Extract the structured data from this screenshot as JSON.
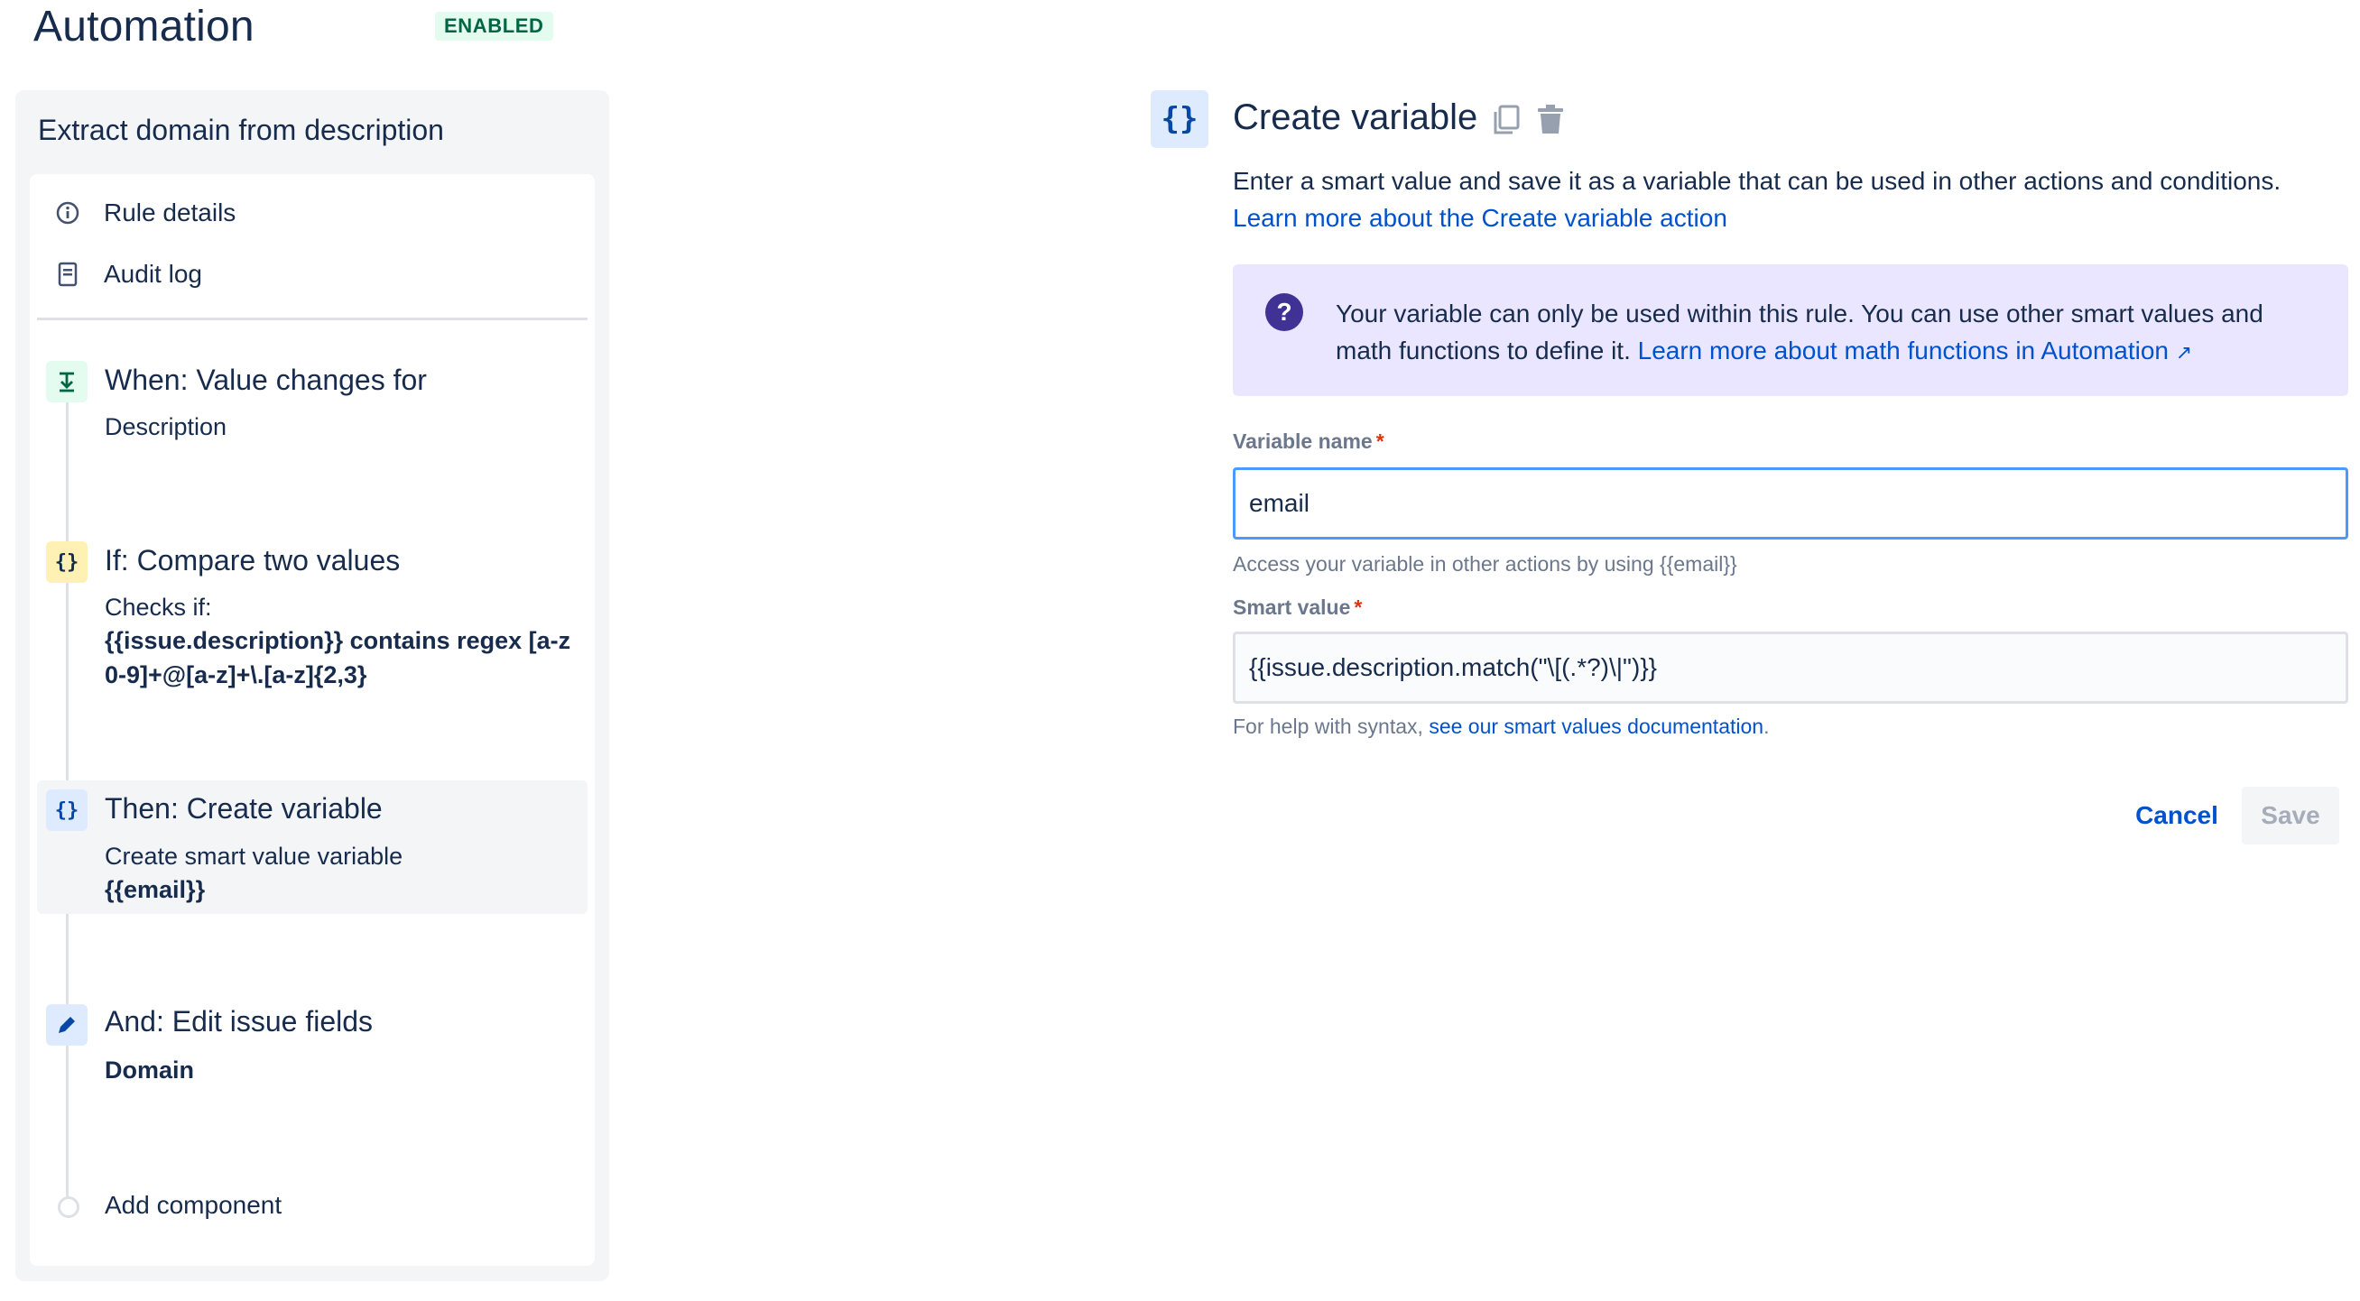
{
  "header": {
    "title": "Automation",
    "status_badge": "ENABLED"
  },
  "rule": {
    "name": "Extract domain from description",
    "nav": [
      {
        "label": "Rule details",
        "icon": "info-icon"
      },
      {
        "label": "Audit log",
        "icon": "document-icon"
      }
    ],
    "steps": {
      "trigger": {
        "title": "When: Value changes for",
        "subtitle": "Description",
        "icon": "field-changed-icon"
      },
      "condition": {
        "title": "If: Compare two values",
        "line1": "Checks if:",
        "detail": "{{issue.description}} contains regex [a-z0-9]+@[a-z]+\\.[a-z]{2,3}",
        "icon": "braces-icon"
      },
      "action1": {
        "title": "Then: Create variable",
        "line1": "Create smart value variable",
        "detail": "{{email}}",
        "icon": "braces-icon"
      },
      "action2": {
        "title": "And: Edit issue fields",
        "detail": "Domain",
        "icon": "pencil-icon"
      }
    },
    "add_component": "Add component"
  },
  "editor": {
    "title": "Create variable",
    "icon_glyph": "{}",
    "description": "Enter a smart value and save it as a variable that can be used in other actions and conditions.",
    "description_link": "Learn more about the Create variable action",
    "info": {
      "text": "Your variable can only be used within this rule. You can use other smart values and math functions to define it.",
      "link": "Learn more about math functions in Automation",
      "link_icon": "↗"
    },
    "variable_name": {
      "label": "Variable name",
      "required_mark": "*",
      "value": "email",
      "helper": "Access your variable in other actions by using {{email}}"
    },
    "smart_value": {
      "label": "Smart value",
      "required_mark": "*",
      "value": "{{issue.description.match(\"\\[(.*?)\\|\")}}",
      "helper_prefix": "For help with syntax,",
      "helper_link": "see our smart values documentation",
      "helper_suffix": "."
    },
    "buttons": {
      "cancel": "Cancel",
      "save": "Save"
    }
  },
  "colors": {
    "primary_text": "#172b4d",
    "link": "#0052cc",
    "enabled_bg": "#e3fcef",
    "enabled_text": "#006644",
    "info_bg": "#eae6ff",
    "info_icon": "#403294",
    "focus_border": "#4c9aff"
  }
}
